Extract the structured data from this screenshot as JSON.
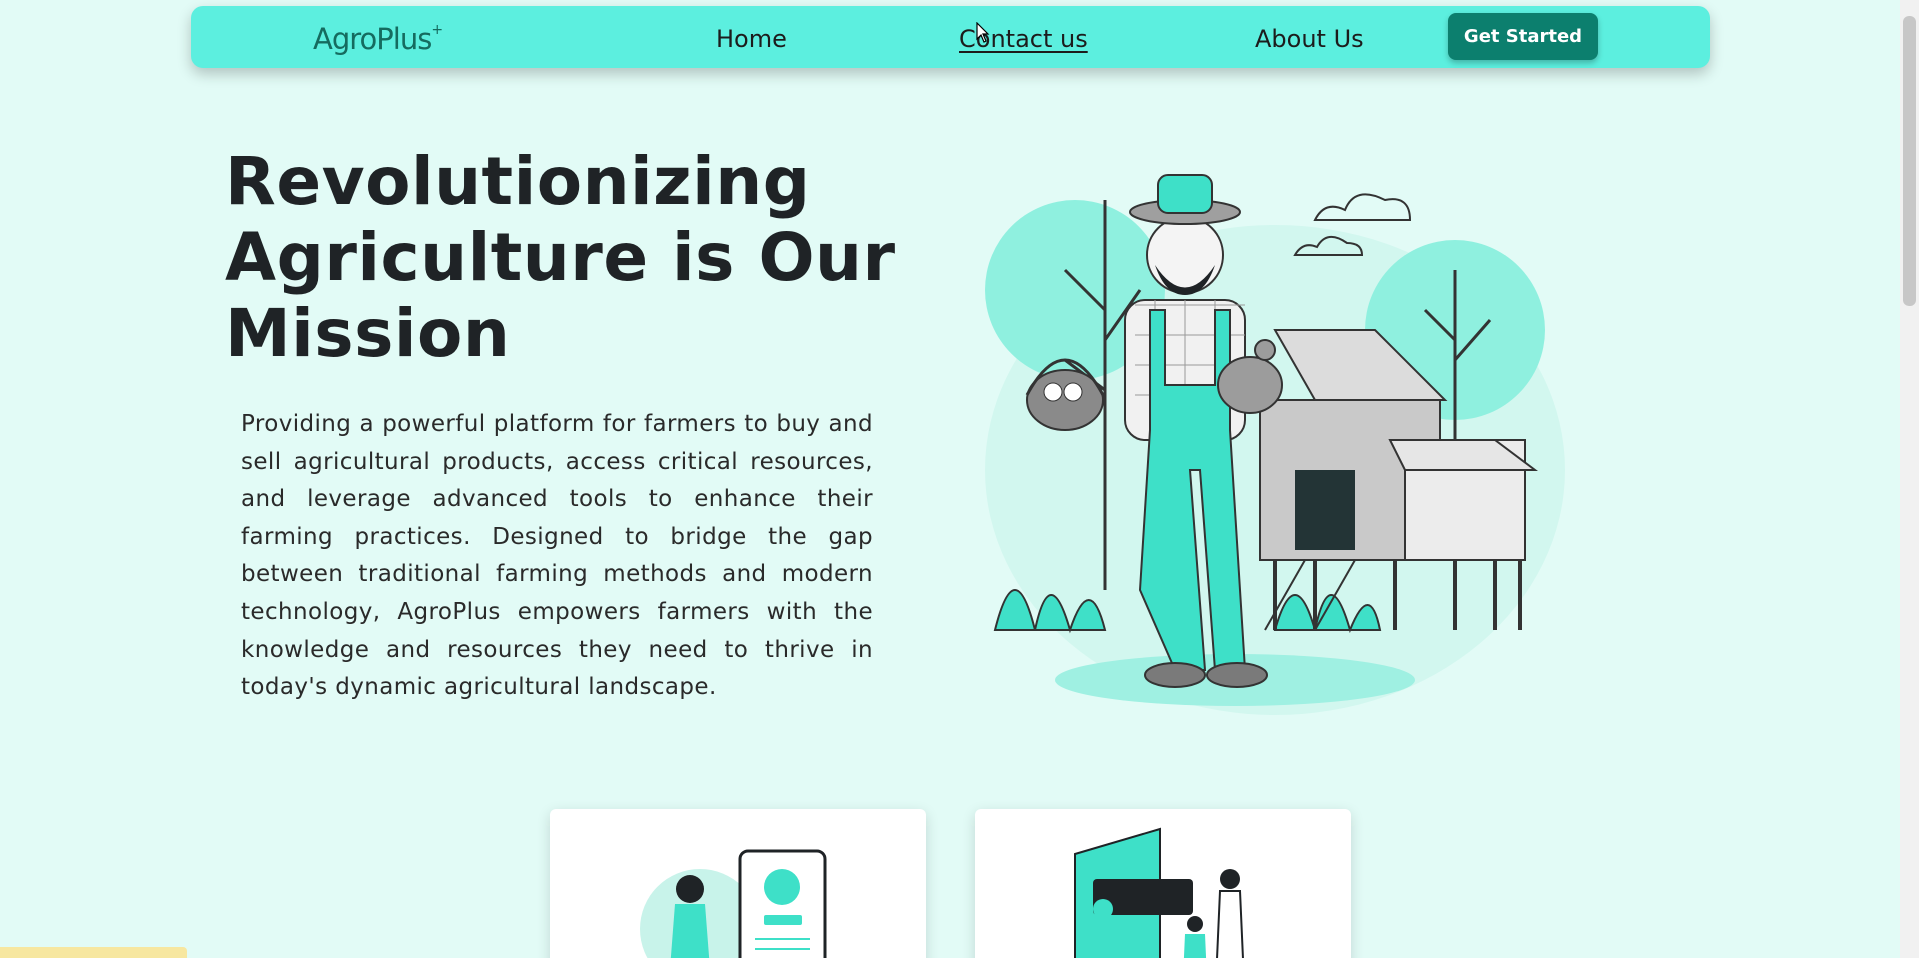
{
  "navbar": {
    "logo": "AgroPlus",
    "logo_mark": "+",
    "links": [
      {
        "label": "Home"
      },
      {
        "label": "Contact us"
      },
      {
        "label": "About Us"
      }
    ],
    "cta_label": "Get Started"
  },
  "hero": {
    "title_lines": [
      "Revolutionizing",
      "Agriculture is Our",
      "Mission"
    ],
    "description": "Providing a powerful platform for farmers to buy and sell agricultural products, access critical resources, and leverage advanced tools to enhance their farming practices. Designed to bridge the gap between traditional farming methods and modern technology, AgroPlus empowers farmers with the knowledge and resources they need to thrive in today's dynamic agricultural landscape.",
    "illustration_icon": "farmer-illustration-icon"
  },
  "cards": [
    {
      "icon": "online-shopping-illustration-icon"
    },
    {
      "icon": "digital-payment-illustration-icon"
    }
  ],
  "colors": {
    "page_bg": "#e2fbf6",
    "navbar_bg": "#5cefdf",
    "accent_dark": "#0c7f6e",
    "logo_color": "#156b5f",
    "text_dark": "#1f2326"
  }
}
